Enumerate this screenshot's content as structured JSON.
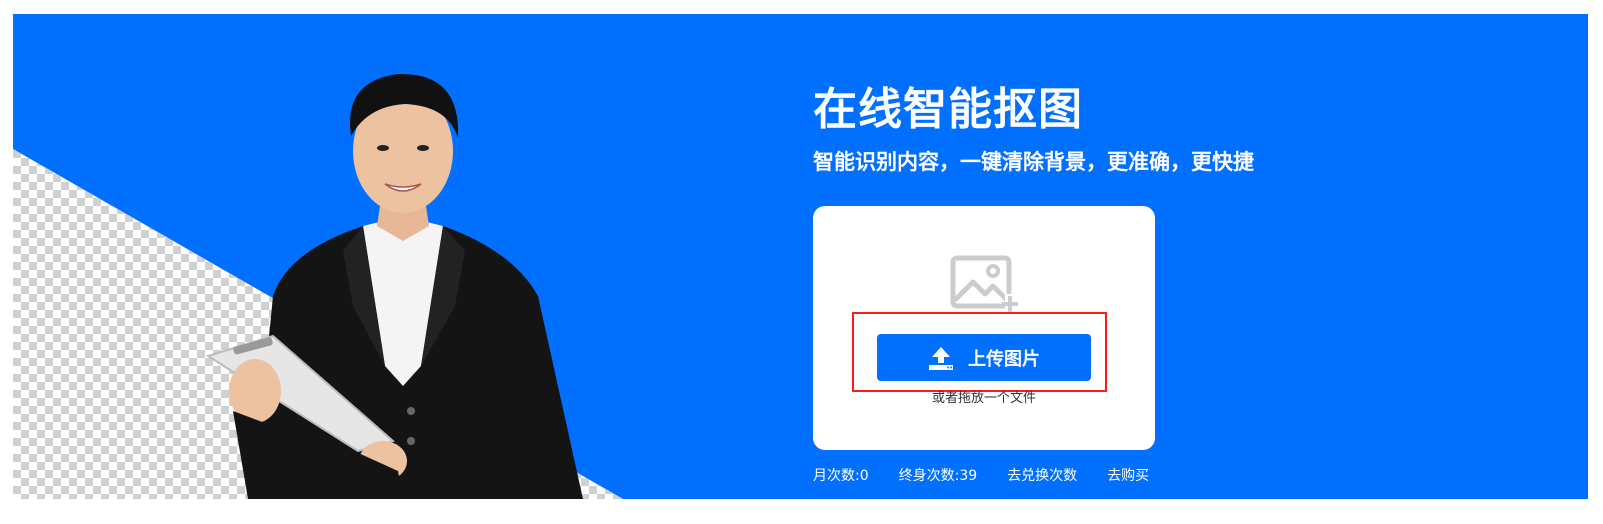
{
  "hero": {
    "title": "在线智能抠图",
    "subtitle": "智能识别内容，一键清除背景，更准确，更快捷"
  },
  "upload": {
    "button_label": "上传图片",
    "drag_hint": "或者拖放一个文件",
    "icon": "image-add-icon",
    "button_icon": "upload-icon"
  },
  "stats": {
    "monthly_label": "月次数:",
    "monthly_value": "0",
    "lifetime_label": "终身次数:",
    "lifetime_value": "39",
    "redeem_link": "去兑换次数",
    "buy_link": "去购买"
  },
  "colors": {
    "brand_blue": "#0270fe",
    "highlight_red": "#ff1a1a",
    "card_white": "#ffffff"
  }
}
